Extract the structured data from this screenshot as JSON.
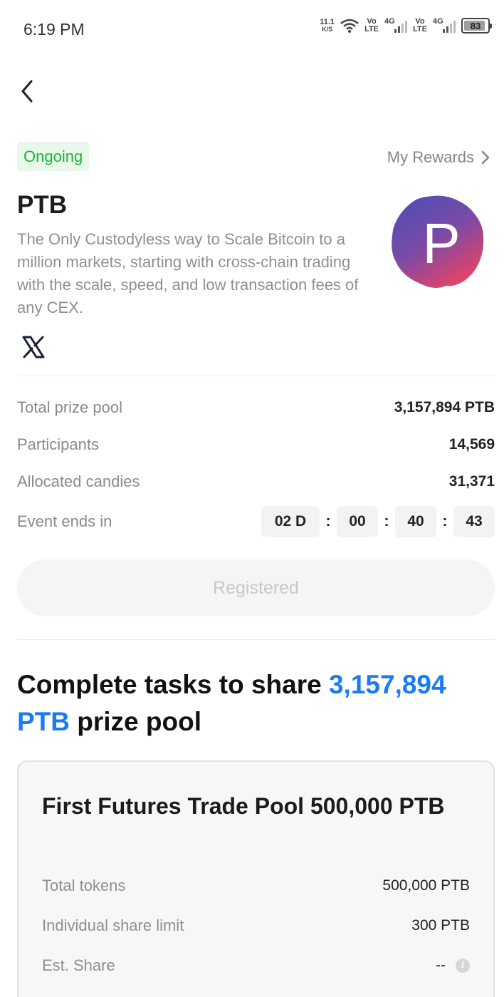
{
  "status_bar": {
    "time": "6:19 PM",
    "net_speed_value": "11.1",
    "net_speed_unit": "K/S",
    "volte_1_top": "Vo",
    "volte_1_bottom": "LTE",
    "signal_1_label": "4G",
    "volte_2_top": "Vo",
    "volte_2_bottom": "LTE",
    "signal_2_label": "4G",
    "battery": "83"
  },
  "header": {
    "status_badge": "Ongoing",
    "rewards_link": "My Rewards"
  },
  "project": {
    "name": "PTB",
    "description": "The Only Custodyless way to Scale Bitcoin to a million markets, starting with cross-chain trading with the scale, speed, and low transaction fees of any CEX.",
    "logo_letter": "P",
    "social": "X"
  },
  "stats": {
    "total_prize_pool_label": "Total prize pool",
    "total_prize_pool_value": "3,157,894 PTB",
    "participants_label": "Participants",
    "participants_value": "14,569",
    "allocated_candies_label": "Allocated candies",
    "allocated_candies_value": "31,371",
    "event_ends_label": "Event ends in",
    "countdown": {
      "days": "02 D",
      "hours": "00",
      "minutes": "40",
      "seconds": "43",
      "separator": ":"
    }
  },
  "register_button": "Registered",
  "headline": {
    "prefix": "Complete tasks to share ",
    "highlight_amount": "3,157,894",
    "highlight_unit": "PTB",
    "suffix": " prize pool"
  },
  "task_card": {
    "title": "First Futures Trade Pool 500,000 PTB",
    "total_tokens_label": "Total tokens",
    "total_tokens_value": "500,000 PTB",
    "share_limit_label": "Individual share limit",
    "share_limit_value": "300 PTB",
    "est_share_label": "Est. Share",
    "est_share_value": "--"
  },
  "colors": {
    "accent_blue": "#1a7bf2",
    "badge_green": "#21b33c",
    "badge_bg": "#e8f8ea",
    "logo_gradient_top": "#4a4fb8",
    "logo_gradient_bottom": "#d8406e"
  },
  "icons": {
    "back": "chevron-left-icon",
    "rewards": "chevron-right-icon",
    "social": "x-logo-icon",
    "info": "info-icon",
    "wifi": "wifi-icon"
  }
}
